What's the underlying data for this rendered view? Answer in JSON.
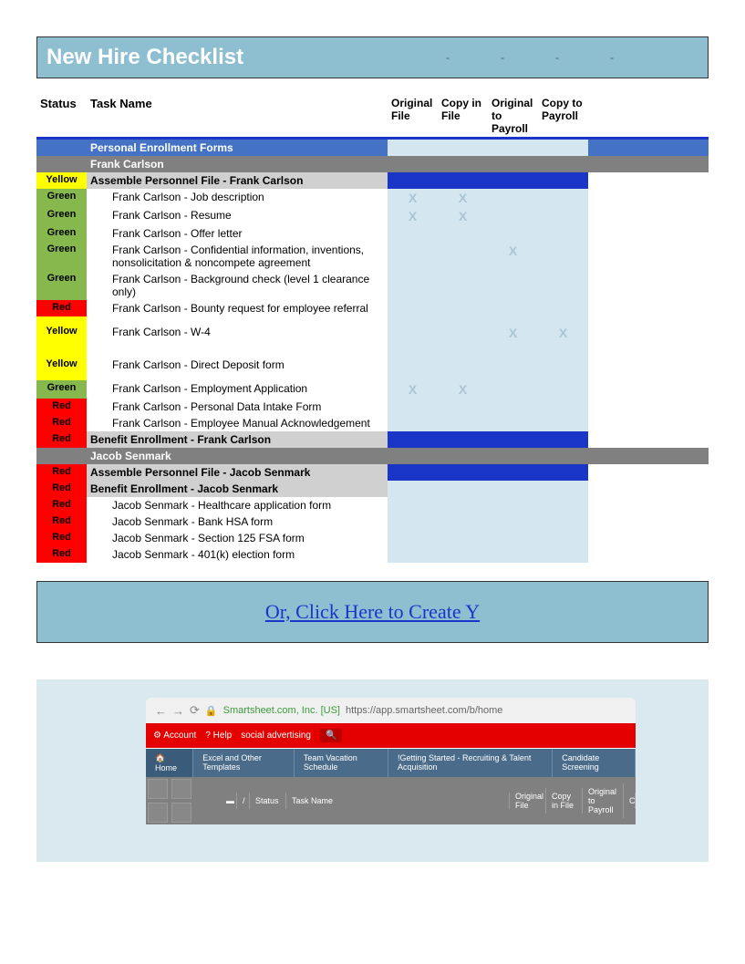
{
  "title": "New Hire Checklist",
  "dashes": [
    "-",
    "-",
    "-",
    "-"
  ],
  "headers": {
    "status": "Status",
    "task": "Task Name",
    "c1": "Original File",
    "c2": "Copy in File",
    "c3": "Original to Payroll",
    "c4": "Copy to Payroll"
  },
  "section_personal": "Personal Enrollment Forms",
  "person1": "Frank Carlson",
  "person2": "Jacob Senmark",
  "rows_p1": [
    {
      "status": "Yellow",
      "statusbg": "bg-yellow",
      "task": "Assemble Personnel File - Frank Carlson",
      "heading": true,
      "blue": true
    },
    {
      "status": "Green",
      "statusbg": "bg-green",
      "task": "Frank Carlson - Job description",
      "c1": "X",
      "c2": "X"
    },
    {
      "status": "Green",
      "statusbg": "bg-green",
      "task": "Frank Carlson - Resume",
      "c1": "X",
      "c2": "X"
    },
    {
      "status": "Green",
      "statusbg": "bg-green",
      "task": "Frank Carlson - Offer letter"
    },
    {
      "status": "Green",
      "statusbg": "bg-green",
      "task": "Frank Carlson - Confidential information, inventions, nonsolicitation & noncompete agreement",
      "c3": "X"
    },
    {
      "status": "Green",
      "statusbg": "bg-green",
      "task": "Frank Carlson - Background check (level 1 clearance only)"
    },
    {
      "status": "Red",
      "statusbg": "bg-red",
      "task": "Frank Carlson - Bounty request for employee referral"
    },
    {
      "status": "Yellow",
      "statusbg": "bg-yellow",
      "task": "Frank Carlson - W-4",
      "c3": "X",
      "c4": "X",
      "tall": true
    },
    {
      "status": "Yellow",
      "statusbg": "bg-yellow",
      "task": "Frank Carlson - Direct Deposit form",
      "tall": true
    },
    {
      "status": "Green",
      "statusbg": "bg-green",
      "task": "Frank Carlson - Employment Application",
      "c1": "X",
      "c2": "X"
    },
    {
      "status": "Red",
      "statusbg": "bg-red",
      "task": "Frank Carlson - Personal Data Intake Form"
    },
    {
      "status": "Red",
      "statusbg": "bg-red",
      "task": "Frank Carlson - Employee Manual Acknowledgement"
    },
    {
      "status": "Red",
      "statusbg": "bg-red",
      "task": "Benefit Enrollment - Frank Carlson",
      "heading": true,
      "blue": true
    }
  ],
  "rows_p2": [
    {
      "status": "Red",
      "statusbg": "bg-red",
      "task": "Assemble Personnel File - Jacob Senmark",
      "heading": true,
      "blue": true
    },
    {
      "status": "Red",
      "statusbg": "bg-red",
      "task": "Benefit Enrollment - Jacob Senmark",
      "heading": true
    },
    {
      "status": "Red",
      "statusbg": "bg-red",
      "task": "Jacob Senmark - Healthcare application form"
    },
    {
      "status": "Red",
      "statusbg": "bg-red",
      "task": "Jacob Senmark - Bank HSA form"
    },
    {
      "status": "Red",
      "statusbg": "bg-red",
      "task": "Jacob Senmark - Section 125 FSA form"
    },
    {
      "status": "Red",
      "statusbg": "bg-red",
      "task": "Jacob Senmark - 401(k) election form"
    }
  ],
  "cta_text": "Or, Click Here to Create Y",
  "browser": {
    "back": "←",
    "fwd": "→",
    "reload": "⟳",
    "lock_icon": "🔒",
    "domain": "Smartsheet.com, Inc. [US]",
    "url": "https://app.smartsheet.com/b/home"
  },
  "app": {
    "account": "⚙ Account",
    "help": "? Help",
    "search_ph": "social advertising",
    "search_icon": "🔍",
    "tabs": [
      "🏠 Home",
      "Excel and Other Templates",
      "Team Vacation Schedule",
      "!Getting Started - Recruiting & Talent Acquisition",
      "Candidate Screening"
    ],
    "gridhead": [
      "Status",
      "Task Name",
      "Original File",
      "Copy in File",
      "Original to Payroll",
      "C"
    ]
  }
}
